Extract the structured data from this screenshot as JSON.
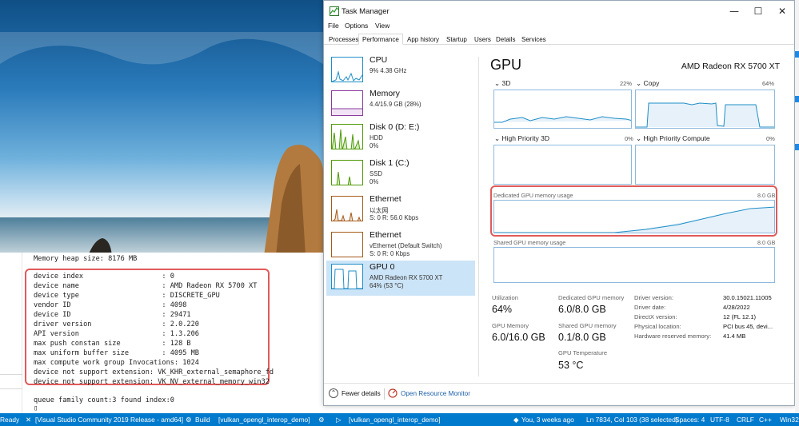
{
  "console": {
    "heap_line": "Memory heap size: 8176 MB",
    "lines": [
      "device index                   : 0",
      "device name                    : AMD Radeon RX 5700 XT",
      "device type                    : DISCRETE_GPU",
      "vendor ID                      : 4098",
      "device ID                      : 29471",
      "driver version                 : 2.0.220",
      "API version                    : 1.3.206",
      "max push constan size          : 128 B",
      "max uniform buffer size        : 4095 MB",
      "max compute work group Invocations: 1024",
      "device not support extension: VK_KHR_external_semaphore_fd",
      "device not support extension: VK_NV_external_memory_win32"
    ],
    "queue_line": "queue family count:3 found index:0",
    "cursor": "▯"
  },
  "taskmanager": {
    "title": "Task Manager",
    "menu": [
      "File",
      "Options",
      "View"
    ],
    "tabs": [
      "Processes",
      "Performance",
      "App history",
      "Startup",
      "Users",
      "Details",
      "Services"
    ],
    "active_tab": "Performance",
    "window_buttons": {
      "minimize": "—",
      "maximize": "☐",
      "close": "✕"
    },
    "sidebar": [
      {
        "title": "CPU",
        "lines": [
          "9% 4.38 GHz"
        ],
        "color": "#1f8ec7"
      },
      {
        "title": "Memory",
        "lines": [
          "4.4/15.9 GB (28%)"
        ],
        "color": "#8b3a9e"
      },
      {
        "title": "Disk 0 (D: E:)",
        "lines": [
          "HDD",
          "0%"
        ],
        "color": "#4e9a06"
      },
      {
        "title": "Disk 1 (C:)",
        "lines": [
          "SSD",
          "0%"
        ],
        "color": "#4e9a06"
      },
      {
        "title": "Ethernet",
        "lines": [
          "以太网",
          "S: 0 R: 56.0 Kbps"
        ],
        "color": "#a45a1c"
      },
      {
        "title": "Ethernet",
        "lines": [
          "vEthernet (Default Switch)",
          "S: 0 R: 0 Kbps"
        ],
        "color": "#a45a1c"
      },
      {
        "title": "GPU 0",
        "lines": [
          "AMD Radeon RX 5700 XT",
          "64% (53 °C)"
        ],
        "color": "#1f8ec7"
      }
    ],
    "gpu": {
      "title": "GPU",
      "model": "AMD Radeon RX 5700 XT",
      "engines": [
        {
          "name": "3D",
          "pct": "22%"
        },
        {
          "name": "Copy",
          "pct": "64%"
        },
        {
          "name": "High Priority 3D",
          "pct": "0%"
        },
        {
          "name": "High Priority Compute",
          "pct": "0%"
        }
      ],
      "dedicated_label": "Dedicated GPU memory usage",
      "dedicated_max": "8.0 GB",
      "shared_label": "Shared GPU memory usage",
      "shared_max": "8.0 GB",
      "stats": {
        "utilization_label": "Utilization",
        "utilization": "64%",
        "dedicated_label": "Dedicated GPU memory",
        "dedicated": "6.0/8.0 GB",
        "gpu_memory_label": "GPU Memory",
        "gpu_memory": "6.0/16.0 GB",
        "shared_label": "Shared GPU memory",
        "shared": "0.1/8.0 GB",
        "temp_label": "GPU Temperature",
        "temp": "53 °C"
      },
      "driver": [
        {
          "label": "Driver version:",
          "value": "30.0.15021.11005"
        },
        {
          "label": "Driver date:",
          "value": "4/28/2022"
        },
        {
          "label": "DirectX version:",
          "value": "12 (FL 12.1)"
        },
        {
          "label": "Physical location:",
          "value": "PCI bus 45, devi..."
        },
        {
          "label": "Hardware reserved memory:",
          "value": "41.4 MB"
        }
      ]
    },
    "footer": {
      "fewer": "Fewer details",
      "monitor": "Open Resource Monitor"
    }
  },
  "statusbar": {
    "ready": "Ready",
    "solution": "[Visual Studio Community 2019 Release - amd64]",
    "build": "Build",
    "target": "[vulkan_opengl_interop_demo]",
    "run_target": "[vulkan_opengl_interop_demo]",
    "git": "You, 3 weeks ago",
    "position": "Ln 7834, Col 103 (38 selected)",
    "spaces": "Spaces: 4",
    "encoding": "UTF-8",
    "eol": "CRLF",
    "language": "C++",
    "platform": "Win32"
  }
}
